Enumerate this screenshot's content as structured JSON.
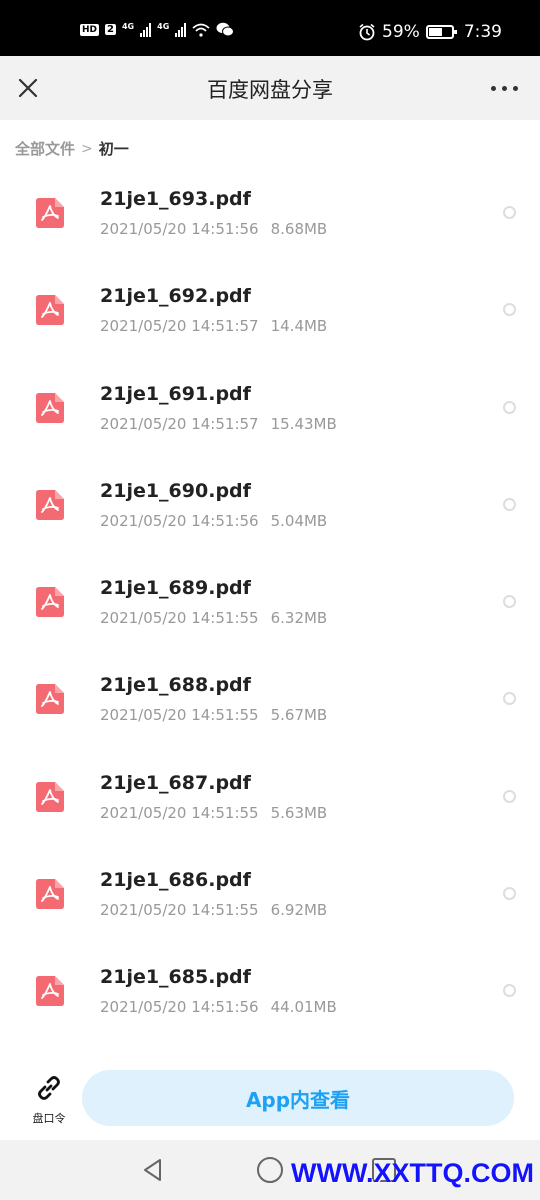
{
  "status_bar": {
    "hd_label": "HD",
    "sim_slot": "2",
    "network1": "4G",
    "network2": "4G",
    "battery": "59%",
    "time": "7:39",
    "battery_level": 0.59
  },
  "nav": {
    "title": "百度网盘分享"
  },
  "breadcrumb": {
    "root": "全部文件",
    "separator": ">",
    "current": "初一"
  },
  "files": [
    {
      "name": "21je1_693.pdf",
      "date": "2021/05/20 14:51:56",
      "size": "8.68MB"
    },
    {
      "name": "21je1_692.pdf",
      "date": "2021/05/20 14:51:57",
      "size": "14.4MB"
    },
    {
      "name": "21je1_691.pdf",
      "date": "2021/05/20 14:51:57",
      "size": "15.43MB"
    },
    {
      "name": "21je1_690.pdf",
      "date": "2021/05/20 14:51:56",
      "size": "5.04MB"
    },
    {
      "name": "21je1_689.pdf",
      "date": "2021/05/20 14:51:55",
      "size": "6.32MB"
    },
    {
      "name": "21je1_688.pdf",
      "date": "2021/05/20 14:51:55",
      "size": "5.67MB"
    },
    {
      "name": "21je1_687.pdf",
      "date": "2021/05/20 14:51:55",
      "size": "5.63MB"
    },
    {
      "name": "21je1_686.pdf",
      "date": "2021/05/20 14:51:55",
      "size": "6.92MB"
    },
    {
      "name": "21je1_685.pdf",
      "date": "2021/05/20 14:51:56",
      "size": "44.01MB"
    }
  ],
  "bottom": {
    "link_label": "盘口令",
    "open_app_label": "App内查看"
  },
  "watermark": "WWW.XXTTQ.COM",
  "colors": {
    "accent": "#1da1f2",
    "button_bg": "#dff1fd",
    "pdf_red": "#f46a73",
    "watermark": "#1313ff"
  },
  "icons": [
    "close-icon",
    "more-icon",
    "pdf-file-icon",
    "link-icon",
    "back-icon",
    "home-icon",
    "recent-apps-icon",
    "wifi-icon",
    "wechat-icon",
    "alarm-icon",
    "battery-icon"
  ]
}
